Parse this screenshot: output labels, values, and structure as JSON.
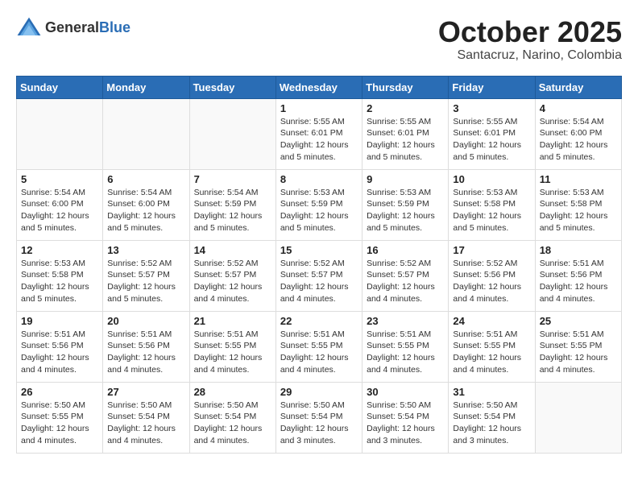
{
  "header": {
    "logo": {
      "text_general": "General",
      "text_blue": "Blue"
    },
    "month_title": "October 2025",
    "location": "Santacruz, Narino, Colombia"
  },
  "calendar": {
    "days_of_week": [
      "Sunday",
      "Monday",
      "Tuesday",
      "Wednesday",
      "Thursday",
      "Friday",
      "Saturday"
    ],
    "weeks": [
      {
        "days": [
          {
            "number": "",
            "info": ""
          },
          {
            "number": "",
            "info": ""
          },
          {
            "number": "",
            "info": ""
          },
          {
            "number": "1",
            "info": "Sunrise: 5:55 AM\nSunset: 6:01 PM\nDaylight: 12 hours\nand 5 minutes."
          },
          {
            "number": "2",
            "info": "Sunrise: 5:55 AM\nSunset: 6:01 PM\nDaylight: 12 hours\nand 5 minutes."
          },
          {
            "number": "3",
            "info": "Sunrise: 5:55 AM\nSunset: 6:01 PM\nDaylight: 12 hours\nand 5 minutes."
          },
          {
            "number": "4",
            "info": "Sunrise: 5:54 AM\nSunset: 6:00 PM\nDaylight: 12 hours\nand 5 minutes."
          }
        ]
      },
      {
        "days": [
          {
            "number": "5",
            "info": "Sunrise: 5:54 AM\nSunset: 6:00 PM\nDaylight: 12 hours\nand 5 minutes."
          },
          {
            "number": "6",
            "info": "Sunrise: 5:54 AM\nSunset: 6:00 PM\nDaylight: 12 hours\nand 5 minutes."
          },
          {
            "number": "7",
            "info": "Sunrise: 5:54 AM\nSunset: 5:59 PM\nDaylight: 12 hours\nand 5 minutes."
          },
          {
            "number": "8",
            "info": "Sunrise: 5:53 AM\nSunset: 5:59 PM\nDaylight: 12 hours\nand 5 minutes."
          },
          {
            "number": "9",
            "info": "Sunrise: 5:53 AM\nSunset: 5:59 PM\nDaylight: 12 hours\nand 5 minutes."
          },
          {
            "number": "10",
            "info": "Sunrise: 5:53 AM\nSunset: 5:58 PM\nDaylight: 12 hours\nand 5 minutes."
          },
          {
            "number": "11",
            "info": "Sunrise: 5:53 AM\nSunset: 5:58 PM\nDaylight: 12 hours\nand 5 minutes."
          }
        ]
      },
      {
        "days": [
          {
            "number": "12",
            "info": "Sunrise: 5:53 AM\nSunset: 5:58 PM\nDaylight: 12 hours\nand 5 minutes."
          },
          {
            "number": "13",
            "info": "Sunrise: 5:52 AM\nSunset: 5:57 PM\nDaylight: 12 hours\nand 5 minutes."
          },
          {
            "number": "14",
            "info": "Sunrise: 5:52 AM\nSunset: 5:57 PM\nDaylight: 12 hours\nand 4 minutes."
          },
          {
            "number": "15",
            "info": "Sunrise: 5:52 AM\nSunset: 5:57 PM\nDaylight: 12 hours\nand 4 minutes."
          },
          {
            "number": "16",
            "info": "Sunrise: 5:52 AM\nSunset: 5:57 PM\nDaylight: 12 hours\nand 4 minutes."
          },
          {
            "number": "17",
            "info": "Sunrise: 5:52 AM\nSunset: 5:56 PM\nDaylight: 12 hours\nand 4 minutes."
          },
          {
            "number": "18",
            "info": "Sunrise: 5:51 AM\nSunset: 5:56 PM\nDaylight: 12 hours\nand 4 minutes."
          }
        ]
      },
      {
        "days": [
          {
            "number": "19",
            "info": "Sunrise: 5:51 AM\nSunset: 5:56 PM\nDaylight: 12 hours\nand 4 minutes."
          },
          {
            "number": "20",
            "info": "Sunrise: 5:51 AM\nSunset: 5:56 PM\nDaylight: 12 hours\nand 4 minutes."
          },
          {
            "number": "21",
            "info": "Sunrise: 5:51 AM\nSunset: 5:55 PM\nDaylight: 12 hours\nand 4 minutes."
          },
          {
            "number": "22",
            "info": "Sunrise: 5:51 AM\nSunset: 5:55 PM\nDaylight: 12 hours\nand 4 minutes."
          },
          {
            "number": "23",
            "info": "Sunrise: 5:51 AM\nSunset: 5:55 PM\nDaylight: 12 hours\nand 4 minutes."
          },
          {
            "number": "24",
            "info": "Sunrise: 5:51 AM\nSunset: 5:55 PM\nDaylight: 12 hours\nand 4 minutes."
          },
          {
            "number": "25",
            "info": "Sunrise: 5:51 AM\nSunset: 5:55 PM\nDaylight: 12 hours\nand 4 minutes."
          }
        ]
      },
      {
        "days": [
          {
            "number": "26",
            "info": "Sunrise: 5:50 AM\nSunset: 5:55 PM\nDaylight: 12 hours\nand 4 minutes."
          },
          {
            "number": "27",
            "info": "Sunrise: 5:50 AM\nSunset: 5:54 PM\nDaylight: 12 hours\nand 4 minutes."
          },
          {
            "number": "28",
            "info": "Sunrise: 5:50 AM\nSunset: 5:54 PM\nDaylight: 12 hours\nand 4 minutes."
          },
          {
            "number": "29",
            "info": "Sunrise: 5:50 AM\nSunset: 5:54 PM\nDaylight: 12 hours\nand 3 minutes."
          },
          {
            "number": "30",
            "info": "Sunrise: 5:50 AM\nSunset: 5:54 PM\nDaylight: 12 hours\nand 3 minutes."
          },
          {
            "number": "31",
            "info": "Sunrise: 5:50 AM\nSunset: 5:54 PM\nDaylight: 12 hours\nand 3 minutes."
          },
          {
            "number": "",
            "info": ""
          }
        ]
      }
    ]
  }
}
